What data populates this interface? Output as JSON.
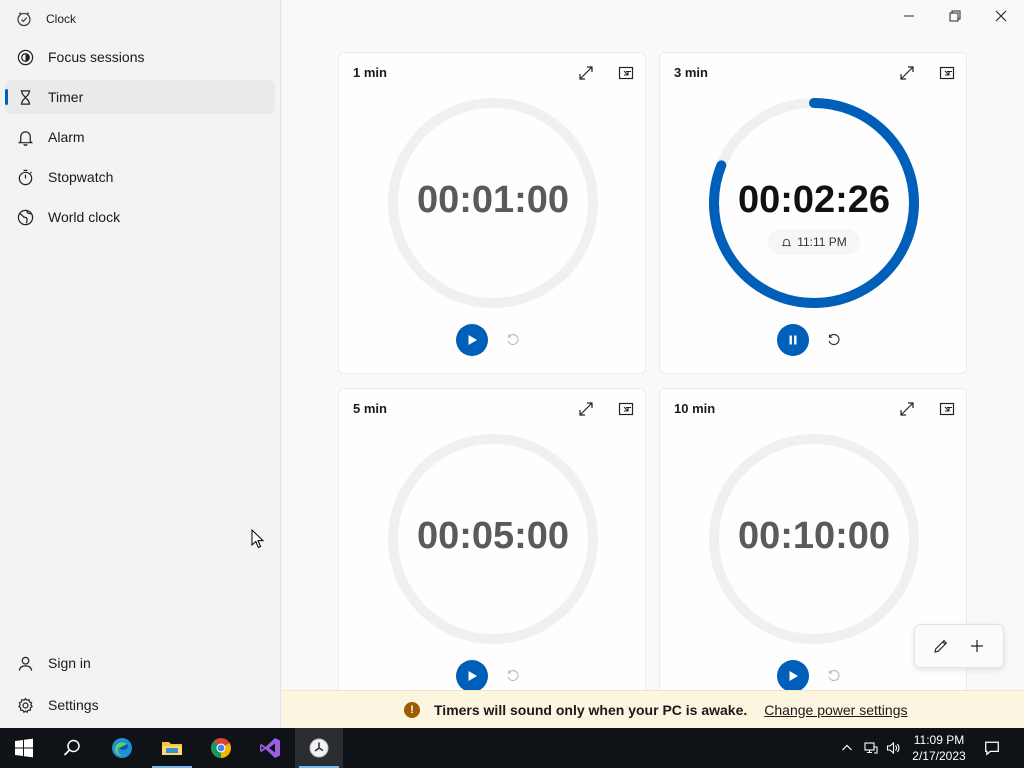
{
  "app": {
    "title": "Clock"
  },
  "sidebar": {
    "items": [
      {
        "label": "Focus sessions",
        "icon": "focus-icon"
      },
      {
        "label": "Timer",
        "icon": "hourglass-icon",
        "active": true
      },
      {
        "label": "Alarm",
        "icon": "bell-icon"
      },
      {
        "label": "Stopwatch",
        "icon": "stopwatch-icon"
      },
      {
        "label": "World clock",
        "icon": "globe-icon"
      }
    ],
    "bottom": [
      {
        "label": "Sign in",
        "icon": "person-icon"
      },
      {
        "label": "Settings",
        "icon": "gear-icon"
      }
    ]
  },
  "timers": [
    {
      "name": "1 min",
      "display": "00:01:00",
      "state": "stopped",
      "progress": 0
    },
    {
      "name": "3 min",
      "display": "00:02:26",
      "state": "running",
      "progress": 0.811,
      "alarm_time": "11:11 PM"
    },
    {
      "name": "5 min",
      "display": "00:05:00",
      "state": "stopped",
      "progress": 0
    },
    {
      "name": "10 min",
      "display": "00:10:00",
      "state": "stopped",
      "progress": 0
    }
  ],
  "banner": {
    "message": "Timers will sound only when your PC is awake.",
    "link": "Change power settings"
  },
  "taskbar": {
    "time": "11:09 PM",
    "date": "2/17/2023"
  },
  "colors": {
    "accent": "#005fb8",
    "ring_track": "#f0f0f0",
    "banner_bg": "#fcf5e0"
  }
}
